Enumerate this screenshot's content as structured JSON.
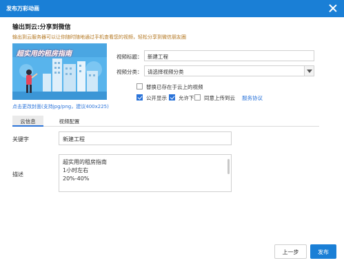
{
  "window": {
    "title": "发布万彩动画"
  },
  "header": {
    "title": "输出到云:分享到微信",
    "subtitle": "输出到云服务器可以让你随时随地通过手机查看您的视频，轻松分享到微信朋友圈"
  },
  "cover": {
    "banner_text": "超实用的租房指南",
    "change_link": "点击更改封面(支持jpg/png，建议400x225)"
  },
  "form": {
    "title_label": "视频标题：",
    "title_value": "新建工程",
    "category_label": "视频分类：",
    "category_value": "请选择视频分类",
    "replace_label": "替换已存在于云上的视频",
    "replace_checked": false,
    "public_label": "公开显示",
    "public_checked": true,
    "download_label": "允许下载",
    "download_checked": true,
    "agree_label": "同意上传到云",
    "agree_checked": false,
    "agreement_link": "服务协议"
  },
  "tabs": [
    {
      "label": "云信息",
      "active": true
    },
    {
      "label": "视频配置",
      "active": false
    }
  ],
  "cloud_info": {
    "keyword_label": "关键字",
    "keyword_value": "新建工程",
    "desc_label": "描述",
    "desc_lines": [
      "超实用的租房指南",
      "1小时左右",
      "20%-40%"
    ]
  },
  "footer": {
    "prev_label": "上一步",
    "publish_label": "发布"
  },
  "colors": {
    "titlebar": "#1a7fd6",
    "accent": "#2a73d9",
    "subtitle": "#b3761f",
    "cover_bg": "#58b4ec"
  }
}
